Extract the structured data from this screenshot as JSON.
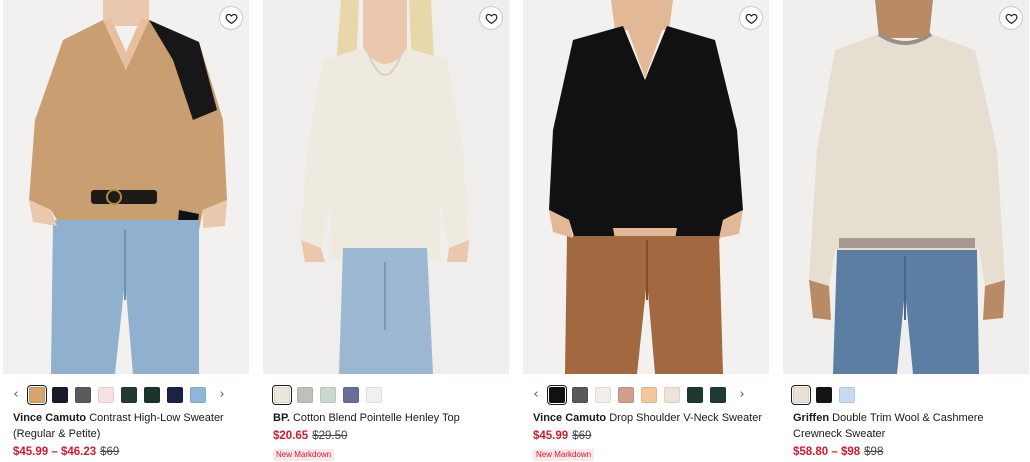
{
  "products": [
    {
      "brand": "Vince Camuto",
      "name": "Contrast High-Low Sweater (Regular & Petite)",
      "price_now": "$45.99 – $46.23",
      "price_was": "$69",
      "badge": "",
      "favorite_icon": "heart-outline-icon",
      "swatches": [
        "#d7a46e",
        "#1a1b2a",
        "#5a5a5c",
        "#f6e3e0",
        "#213a33",
        "#183528",
        "#1c2245",
        "#8fb6da"
      ],
      "selected_swatch": 0,
      "has_arrows": true
    },
    {
      "brand": "BP.",
      "name": "Cotton Blend Pointelle Henley Top",
      "price_now": "$20.65",
      "price_was": "$29.50",
      "badge": "New Markdown",
      "favorite_icon": "heart-outline-icon",
      "swatches": [
        "#ece7da",
        "#bfc0b9",
        "#c8d8cf",
        "#6a6e97",
        "#f1f0ec"
      ],
      "selected_swatch": 0,
      "has_arrows": false
    },
    {
      "brand": "Vince Camuto",
      "name": "Drop Shoulder V-Neck Sweater",
      "price_now": "$45.99",
      "price_was": "$69",
      "badge": "New Markdown",
      "favorite_icon": "heart-outline-icon",
      "swatches": [
        "#111112",
        "#58585a",
        "#f3efe6",
        "#cf9f8c",
        "#f3c69c",
        "#efe3d7",
        "#1c3a31",
        "#1f3a34"
      ],
      "selected_swatch": 0,
      "has_arrows": true
    },
    {
      "brand": "Griffen",
      "name": "Double Trim Wool & Cashmere Crewneck Sweater",
      "price_now": "$58.80 – $98",
      "price_was": "$98",
      "badge": "",
      "favorite_icon": "heart-outline-icon",
      "swatches": [
        "#e8e1d4",
        "#141414",
        "#c6dbef"
      ],
      "selected_swatch": 0,
      "has_arrows": false
    }
  ],
  "arrows": {
    "prev": "‹",
    "next": "›"
  },
  "colors": {
    "sale_red": "#d2182f",
    "badge_bg": "#fde8e8",
    "text": "#191a1b"
  }
}
